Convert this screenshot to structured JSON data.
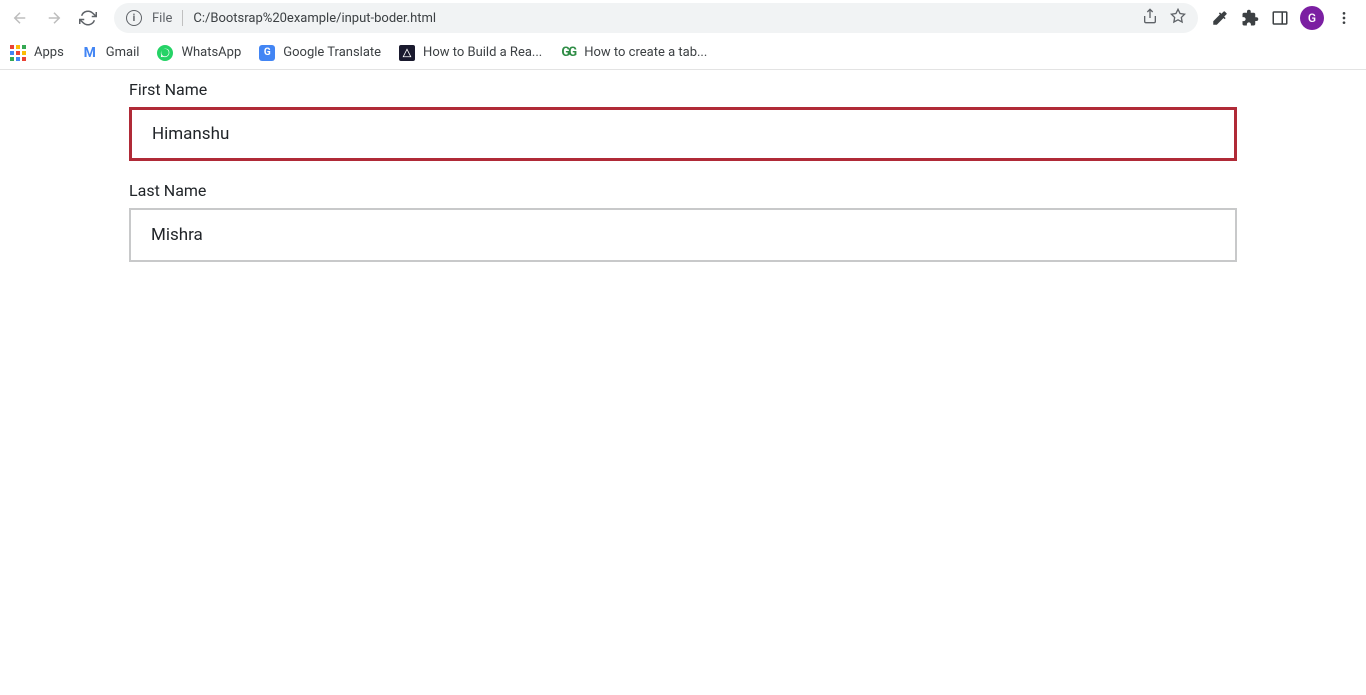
{
  "browser": {
    "url_type": "File",
    "url_path": "C:/Bootsrap%20example/input-boder.html",
    "profile_initial": "G"
  },
  "bookmarks": {
    "apps": "Apps",
    "gmail": "Gmail",
    "whatsapp": "WhatsApp",
    "gtranslate": "Google Translate",
    "howbuild": "How to Build a Rea...",
    "howcreate": "How to create a tab..."
  },
  "form": {
    "first_name_label": "First Name",
    "first_name_value": "Himanshu",
    "last_name_label": "Last Name",
    "last_name_value": "Mishra"
  }
}
